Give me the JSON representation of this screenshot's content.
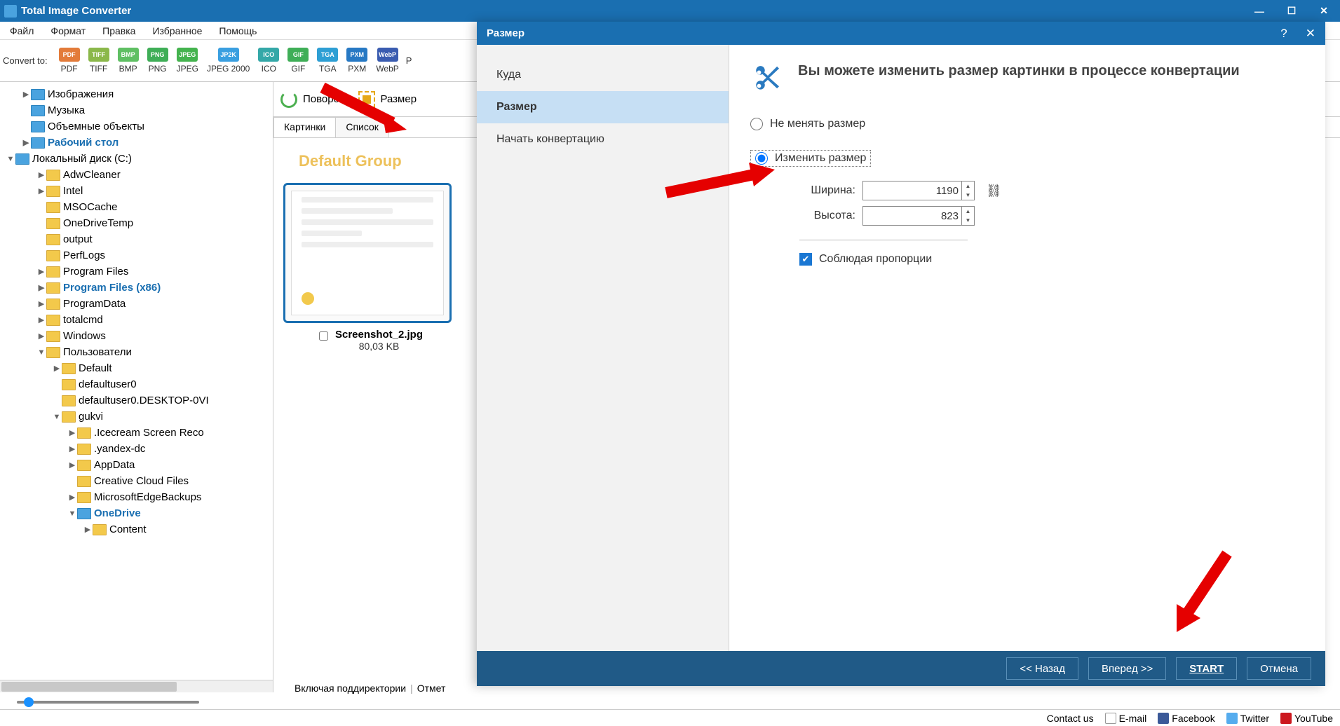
{
  "titlebar": {
    "title": "Total Image Converter"
  },
  "menu": {
    "file": "Файл",
    "format": "Формат",
    "edit": "Правка",
    "fav": "Избранное",
    "help": "Помощь"
  },
  "toolbar": {
    "label": "Convert to:",
    "formats": [
      {
        "badge": "PDF",
        "label": "PDF",
        "color": "#e37b3a"
      },
      {
        "badge": "TIFF",
        "label": "TIFF",
        "color": "#8bb84a"
      },
      {
        "badge": "BMP",
        "label": "BMP",
        "color": "#5fbf63"
      },
      {
        "badge": "PNG",
        "label": "PNG",
        "color": "#3fae57"
      },
      {
        "badge": "JPEG",
        "label": "JPEG",
        "color": "#44b34e"
      },
      {
        "badge": "JP2K",
        "label": "JPEG 2000",
        "color": "#3a9fe0"
      },
      {
        "badge": "ICO",
        "label": "ICO",
        "color": "#34a8a8"
      },
      {
        "badge": "GIF",
        "label": "GIF",
        "color": "#3fae57"
      },
      {
        "badge": "TGA",
        "label": "TGA",
        "color": "#2e9fd4"
      },
      {
        "badge": "PXM",
        "label": "PXM",
        "color": "#2779c4"
      },
      {
        "badge": "WebP",
        "label": "WebP",
        "color": "#3a5cb0"
      }
    ],
    "more": "P"
  },
  "tree": [
    {
      "d": 1,
      "a": "▶",
      "i": "spec",
      "t": "Изображения"
    },
    {
      "d": 1,
      "a": "",
      "i": "spec",
      "t": "Музыка"
    },
    {
      "d": 1,
      "a": "",
      "i": "spec",
      "t": "Объемные объекты"
    },
    {
      "d": 1,
      "a": "▶",
      "i": "spec",
      "t": "Рабочий стол",
      "b": true
    },
    {
      "d": 0,
      "a": "▼",
      "i": "spec",
      "t": "Локальный диск (C:)"
    },
    {
      "d": 2,
      "a": "▶",
      "i": "f",
      "t": "AdwCleaner"
    },
    {
      "d": 2,
      "a": "▶",
      "i": "f",
      "t": "Intel"
    },
    {
      "d": 2,
      "a": "",
      "i": "f",
      "t": "MSOCache"
    },
    {
      "d": 2,
      "a": "",
      "i": "f",
      "t": "OneDriveTemp"
    },
    {
      "d": 2,
      "a": "",
      "i": "f",
      "t": "output"
    },
    {
      "d": 2,
      "a": "",
      "i": "f",
      "t": "PerfLogs"
    },
    {
      "d": 2,
      "a": "▶",
      "i": "f",
      "t": "Program Files"
    },
    {
      "d": 2,
      "a": "▶",
      "i": "f",
      "t": "Program Files (x86)",
      "b": true
    },
    {
      "d": 2,
      "a": "▶",
      "i": "f",
      "t": "ProgramData"
    },
    {
      "d": 2,
      "a": "▶",
      "i": "f",
      "t": "totalcmd"
    },
    {
      "d": 2,
      "a": "▶",
      "i": "f",
      "t": "Windows"
    },
    {
      "d": 2,
      "a": "▼",
      "i": "f",
      "t": "Пользователи"
    },
    {
      "d": 3,
      "a": "▶",
      "i": "f",
      "t": "Default"
    },
    {
      "d": 3,
      "a": "",
      "i": "f",
      "t": "defaultuser0"
    },
    {
      "d": 3,
      "a": "",
      "i": "f",
      "t": "defaultuser0.DESKTOP-0VI"
    },
    {
      "d": 3,
      "a": "▼",
      "i": "f",
      "t": "gukvi"
    },
    {
      "d": 4,
      "a": "▶",
      "i": "f",
      "t": ".Icecream Screen Reco"
    },
    {
      "d": 4,
      "a": "▶",
      "i": "f",
      "t": ".yandex-dc"
    },
    {
      "d": 4,
      "a": "▶",
      "i": "f",
      "t": "AppData"
    },
    {
      "d": 4,
      "a": "",
      "i": "f",
      "t": "Creative Cloud Files"
    },
    {
      "d": 4,
      "a": "▶",
      "i": "f",
      "t": "MicrosoftEdgeBackups"
    },
    {
      "d": 4,
      "a": "▼",
      "i": "spec",
      "t": "OneDrive",
      "b": true
    },
    {
      "d": 5,
      "a": "▶",
      "i": "f",
      "t": "Content"
    }
  ],
  "content": {
    "rotate": "Поворот",
    "resize": "Размер",
    "tab_pics": "Картинки",
    "tab_list": "Список",
    "group": "Default Group",
    "file": {
      "name": "Screenshot_2.jpg",
      "size": "80,03 KB"
    }
  },
  "status": {
    "subdirs": "Включая поддиректории",
    "mark": "Отмет"
  },
  "footer": {
    "contact": "Contact us",
    "email": "E-mail",
    "fb": "Facebook",
    "tw": "Twitter",
    "yt": "YouTube"
  },
  "dialog": {
    "title": "Размер",
    "nav": {
      "dest": "Куда",
      "size": "Размер",
      "start": "Начать конвертацию"
    },
    "heading": "Вы можете изменить размер картинки в процессе конвертации",
    "opt_keep": "Не менять размер",
    "opt_resize": "Изменить размер",
    "width_label": "Ширина:",
    "width": "1190",
    "height_label": "Высота:",
    "height": "823",
    "keep_ratio": "Соблюдая пропорции",
    "back": "<< Назад",
    "next": "Вперед >>",
    "start_btn": "START",
    "cancel": "Отмена"
  }
}
